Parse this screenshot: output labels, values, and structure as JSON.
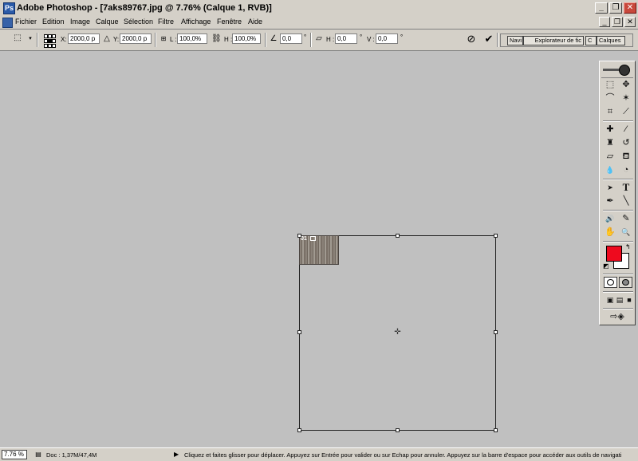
{
  "window": {
    "title": "Adobe Photoshop - [7aks89767.jpg @ 7.76% (Calque 1, RVB)]",
    "app_icon_glyph": "Ps",
    "minimize_glyph": "_",
    "maximize_glyph": "❐",
    "close_glyph": "✕"
  },
  "menubar": {
    "items": [
      "Fichier",
      "Edition",
      "Image",
      "Calque",
      "Sélection",
      "Filtre",
      "Affichage",
      "Fenêtre",
      "Aide"
    ],
    "doc_minimize_glyph": "_",
    "doc_restore_glyph": "❐",
    "doc_close_glyph": "✕"
  },
  "options_bar": {
    "x_label": "X:",
    "x_value": "2000,0 p",
    "y_label": "Y:",
    "y_value": "2000,0 p",
    "w_label": "L :",
    "w_value": "100,0%",
    "h_label": "H :",
    "h_value": "100,0%",
    "angle_value": "0,0",
    "angle_unit": "°",
    "skew_h_label": "H :",
    "skew_h_value": "0,0",
    "skew_h_unit": "°",
    "skew_v_label": "V :",
    "skew_v_value": "0,0",
    "skew_v_unit": "°",
    "cancel_glyph": "⊘",
    "commit_glyph": "✔"
  },
  "palette_well": {
    "tabs": [
      "Navi",
      "Explorateur de fic",
      "C",
      "Calques"
    ]
  },
  "canvas": {
    "layer_thumb_label": "01"
  },
  "toolbox": {
    "colors": {
      "foreground": "#ee0a1e",
      "background": "#ffffff"
    },
    "tools": [
      {
        "icon": "marquee-icon",
        "glyph": "⬚"
      },
      {
        "icon": "move-icon",
        "glyph": "✥"
      },
      {
        "icon": "lasso-icon",
        "glyph": "⌒"
      },
      {
        "icon": "magic-wand-icon",
        "glyph": "✶"
      },
      {
        "icon": "crop-icon",
        "glyph": "⌗"
      },
      {
        "icon": "slice-icon",
        "glyph": "⟋"
      },
      {
        "icon": "healing-brush-icon",
        "glyph": "✚"
      },
      {
        "icon": "brush-icon",
        "glyph": "⁄"
      },
      {
        "icon": "clone-stamp-icon",
        "glyph": "♜"
      },
      {
        "icon": "history-brush-icon",
        "glyph": "↺"
      },
      {
        "icon": "eraser-icon",
        "glyph": "▱"
      },
      {
        "icon": "paint-bucket-icon",
        "glyph": "⛾"
      },
      {
        "icon": "blur-icon",
        "glyph": "💧"
      },
      {
        "icon": "dodge-icon",
        "glyph": "◔"
      },
      {
        "icon": "path-selection-icon",
        "glyph": "➤"
      },
      {
        "icon": "type-icon",
        "glyph": "T"
      },
      {
        "icon": "pen-icon",
        "glyph": "✒"
      },
      {
        "icon": "line-icon",
        "glyph": "╲"
      },
      {
        "icon": "notes-icon",
        "glyph": "🔊"
      },
      {
        "icon": "eyedropper-icon",
        "glyph": "✎"
      },
      {
        "icon": "hand-icon",
        "glyph": "✋"
      },
      {
        "icon": "zoom-icon",
        "glyph": "🔍"
      }
    ]
  },
  "status_bar": {
    "zoom": "7.76 %",
    "doc_info": "Doc : 1,37M/47,4M",
    "arrow_glyph": "▶",
    "hint": "Cliquez et faites glisser pour déplacer. Appuyez sur Entrée pour valider ou sur Echap pour annuler. Appuyez sur la barre d'espace pour accéder aux outils de navigati"
  }
}
